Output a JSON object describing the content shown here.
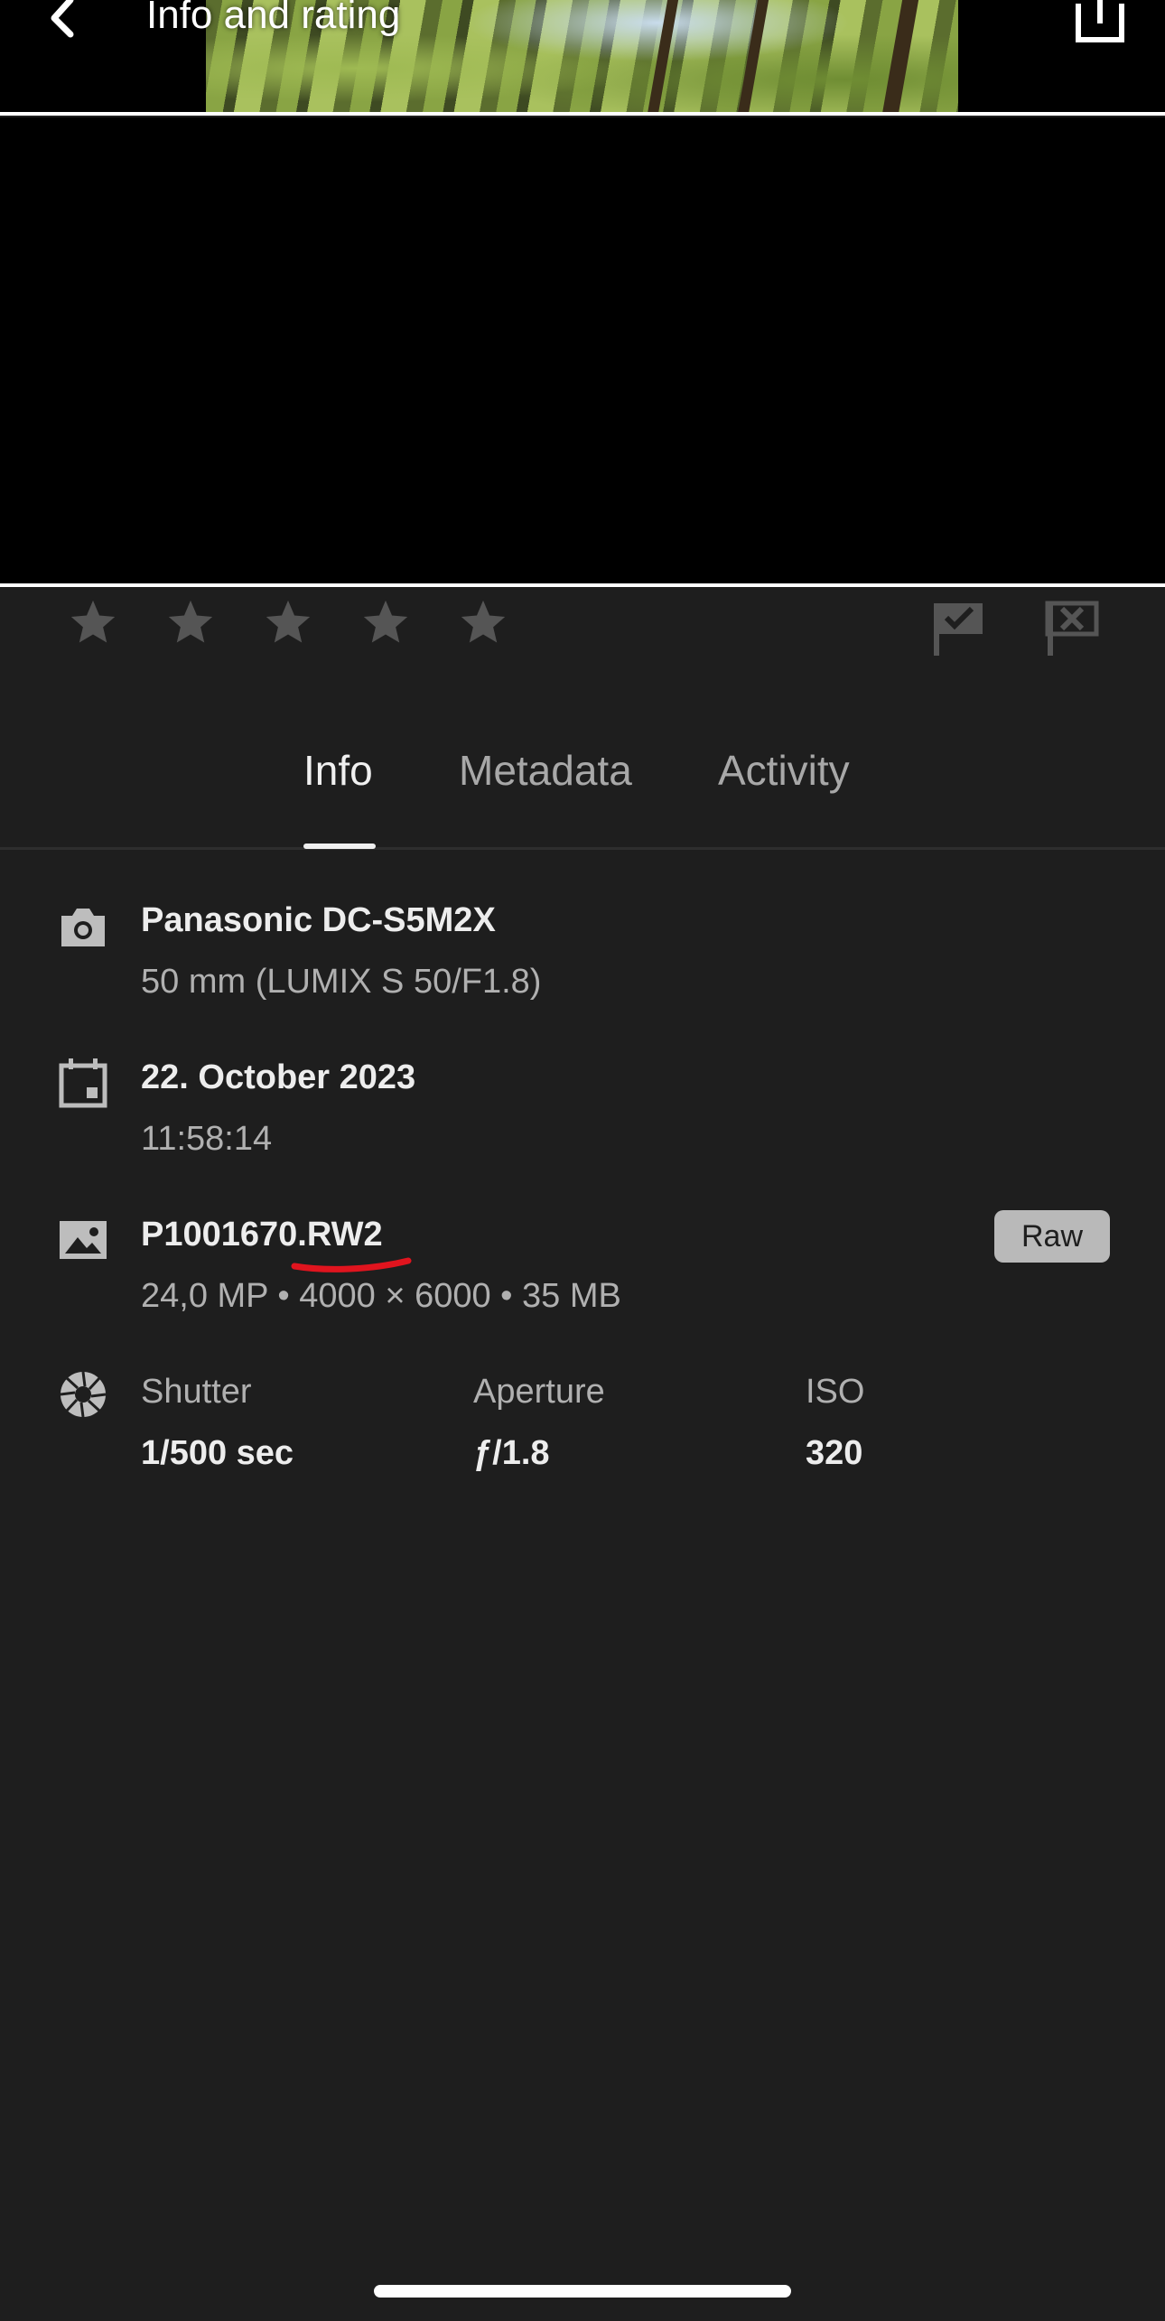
{
  "header": {
    "title": "Info and rating"
  },
  "rating": {
    "stars": 5,
    "value": 0,
    "color": "#555555"
  },
  "tabs": [
    {
      "label": "Info",
      "active": true
    },
    {
      "label": "Metadata",
      "active": false
    },
    {
      "label": "Activity",
      "active": false
    }
  ],
  "info": {
    "camera": {
      "icon": "camera-icon",
      "model": "Panasonic DC-S5M2X",
      "lens": "50 mm (LUMIX S 50/F1.8)"
    },
    "date": {
      "icon": "calendar-icon",
      "date": "22. October 2023",
      "time": "11:58:14"
    },
    "file": {
      "icon": "image-icon",
      "name": "P1001670.RW2",
      "details": "24,0 MP • 4000 × 6000 • 35 MB",
      "badge": "Raw"
    },
    "exposure": {
      "icon": "aperture-icon",
      "shutter_label": "Shutter",
      "shutter_value": "1/500 sec",
      "aperture_label": "Aperture",
      "aperture_value": "ƒ/1.8",
      "iso_label": "ISO",
      "iso_value": "320"
    }
  },
  "annotation_color": "#e0141e"
}
